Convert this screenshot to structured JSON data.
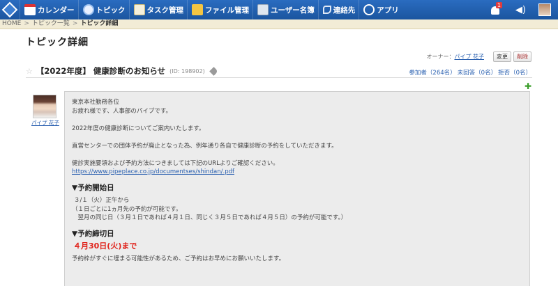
{
  "nav": {
    "items": [
      {
        "label": "カレンダー",
        "icon": "calendar-icon"
      },
      {
        "label": "トピック",
        "icon": "topic-bubble-icon"
      },
      {
        "label": "タスク管理",
        "icon": "task-clipboard-icon"
      },
      {
        "label": "ファイル管理",
        "icon": "folder-icon"
      },
      {
        "label": "ユーザー名簿",
        "icon": "user-directory-icon"
      },
      {
        "label": "連絡先",
        "icon": "phone-icon"
      },
      {
        "label": "アプリ",
        "icon": "gear-icon"
      }
    ],
    "notification_count": "1",
    "bar_color": "#1f5faf"
  },
  "breadcrumb": {
    "home": "HOME",
    "list": "トピック一覧",
    "current": "トピック詳細"
  },
  "page": {
    "title": "トピック詳細"
  },
  "topic": {
    "owner_label": "オーナー：",
    "owner_name": "パイプ 花子",
    "edit_label": "変更",
    "delete_label": "削除",
    "title": "【2022年度】 健康診断のお知らせ",
    "id": "(ID: 198902)",
    "participants": "参加者（264名）",
    "unanswered": "未回答（0名）",
    "declined": "拒否（0名）",
    "author_name": "パイプ 花子"
  },
  "body": {
    "lines_intro": [
      "東京本社勤務各位",
      "お疲れ様です、人事部のパイプです。"
    ],
    "line_year": "2022年度の健康診断についてご案内いたします。",
    "line_direct": "直営センターでの団体予約が廃止となった為、例年通り各自で健康診断の予約をしていただきます。",
    "line_info": "健診実施要領および予約方法につきましては下記のURLよりご確認ください。",
    "link": "https://www.pipeplace.co.jp/documentses/shindan/.pdf",
    "section_start": "▼予約開始日",
    "start_lines": [
      "３/１（火）正午から",
      "（１日ごとに1ヵ月先の予約が可能です。",
      "　翌月の同じ日（３月１日であれば４月１日、同じく３月５日であれば４月５日）の予約が可能です。）"
    ],
    "section_end": "▼予約締切日",
    "deadline": "４月30日(火)まで",
    "closing": "予約枠がすぐに埋まる可能性があるため、ご予約はお早めにお願いいたします。"
  },
  "colors": {
    "accent_link": "#2a60b0",
    "deadline_red": "#e0221a",
    "crumb_bg": "#f2ecd6"
  }
}
